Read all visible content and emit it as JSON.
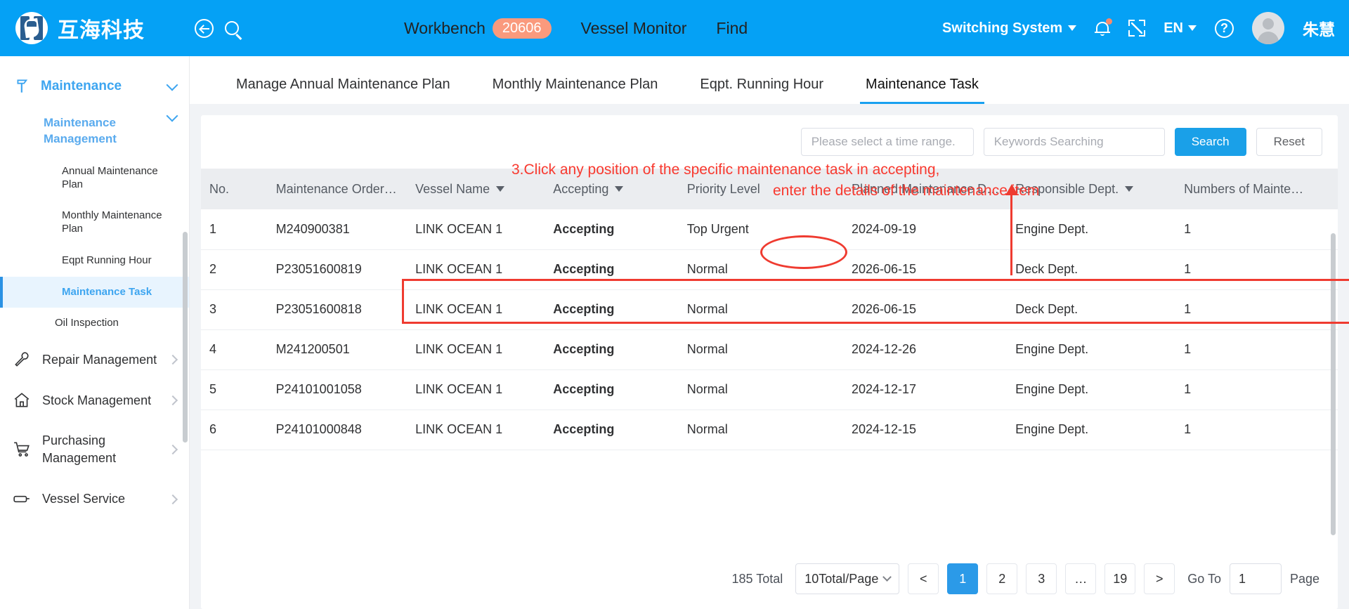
{
  "header": {
    "brand_name": "互海科技",
    "back_icon": "back-circle-icon",
    "search_icon": "search-icon",
    "nav": [
      {
        "label": "Workbench",
        "badge": "20606"
      },
      {
        "label": "Vessel Monitor",
        "badge": ""
      },
      {
        "label": "Find",
        "badge": ""
      }
    ],
    "switching_system": "Switching System",
    "language": "EN",
    "username": "朱慧",
    "accent_color": "#05a1f5",
    "badge_color": "#fa9a7d"
  },
  "sidebar": {
    "group": {
      "label": "Maintenance",
      "icon": "hammer-icon"
    },
    "subgroup": {
      "label": "Maintenance Management"
    },
    "leaves": [
      {
        "label": "Annual Maintenance Plan",
        "active": false
      },
      {
        "label": "Monthly Maintenance Plan",
        "active": false
      },
      {
        "label": "Eqpt Running Hour",
        "active": false
      },
      {
        "label": "Maintenance Task",
        "active": true
      },
      {
        "label": "Oil Inspection",
        "active": false
      }
    ],
    "mains": [
      {
        "label": "Repair Management",
        "icon": "wrench-icon"
      },
      {
        "label": "Stock Management",
        "icon": "home-icon"
      },
      {
        "label": "Purchasing Management",
        "icon": "cart-icon"
      },
      {
        "label": "Vessel Service",
        "icon": "ship-icon"
      }
    ]
  },
  "tabs": [
    {
      "label": "Manage Annual Maintenance Plan",
      "active": false
    },
    {
      "label": "Monthly Maintenance Plan",
      "active": false
    },
    {
      "label": "Eqpt. Running Hour",
      "active": false
    },
    {
      "label": "Maintenance Task",
      "active": true
    }
  ],
  "toolbar": {
    "time_placeholder": "Please select a time range.",
    "keywords_placeholder": "Keywords Searching",
    "search_label": "Search",
    "reset_label": "Reset"
  },
  "table": {
    "columns": [
      {
        "label": "No.",
        "sortable": false
      },
      {
        "label": "Maintenance Order…",
        "sortable": false
      },
      {
        "label": "Vessel Name",
        "sortable": true
      },
      {
        "label": "Accepting",
        "sortable": true
      },
      {
        "label": "Priority Level",
        "sortable": false
      },
      {
        "label": "Planned Maintenance D…",
        "sortable": false
      },
      {
        "label": "Responsible Dept.",
        "sortable": true
      },
      {
        "label": "Numbers of Mainte…",
        "sortable": false
      }
    ],
    "rows": [
      {
        "no": "1",
        "order": "M240900381",
        "vessel": "LINK OCEAN 1",
        "status": "Accepting",
        "priority": "Top Urgent",
        "date": "2024-09-19",
        "dept": "Engine Dept.",
        "num": "1",
        "highlight": true
      },
      {
        "no": "2",
        "order": "P23051600819",
        "vessel": "LINK OCEAN 1",
        "status": "Accepting",
        "priority": "Normal",
        "date": "2026-06-15",
        "dept": "Deck Dept.",
        "num": "1",
        "highlight": false
      },
      {
        "no": "3",
        "order": "P23051600818",
        "vessel": "LINK OCEAN 1",
        "status": "Accepting",
        "priority": "Normal",
        "date": "2026-06-15",
        "dept": "Deck Dept.",
        "num": "1",
        "highlight": false
      },
      {
        "no": "4",
        "order": "M241200501",
        "vessel": "LINK OCEAN 1",
        "status": "Accepting",
        "priority": "Normal",
        "date": "2024-12-26",
        "dept": "Engine Dept.",
        "num": "1",
        "highlight": false
      },
      {
        "no": "5",
        "order": "P24101001058",
        "vessel": "LINK OCEAN 1",
        "status": "Accepting",
        "priority": "Normal",
        "date": "2024-12-17",
        "dept": "Engine Dept.",
        "num": "1",
        "highlight": false
      },
      {
        "no": "6",
        "order": "P24101000848",
        "vessel": "LINK OCEAN 1",
        "status": "Accepting",
        "priority": "Normal",
        "date": "2024-12-15",
        "dept": "Engine Dept.",
        "num": "1",
        "highlight": false
      }
    ]
  },
  "pagination": {
    "total_label": "185 Total",
    "page_size": "10Total/Page",
    "prev": "<",
    "next": ">",
    "pages": [
      "1",
      "2",
      "3",
      "…",
      "19"
    ],
    "current_page": "1",
    "goto_label": "Go To",
    "goto_value": "1",
    "page_label": "Page"
  },
  "annotations": {
    "line1": "3.Click any position of the specific maintenance task in accepting,",
    "line2": "enter the details of the maintenance item",
    "color": "#f8392f"
  }
}
